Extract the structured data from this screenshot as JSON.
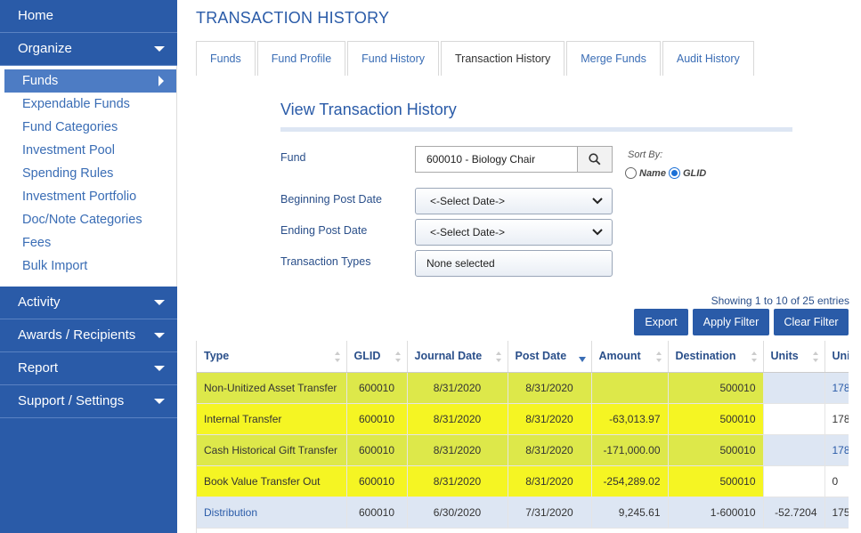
{
  "sidebar": {
    "home": "Home",
    "organize": "Organize",
    "organize_items": [
      "Funds",
      "Expendable Funds",
      "Fund Categories",
      "Investment Pool",
      "Spending Rules",
      "Investment Portfolio",
      "Doc/Note Categories",
      "Fees",
      "Bulk Import"
    ],
    "activity": "Activity",
    "awards": "Awards / Recipients",
    "report": "Report",
    "support": "Support / Settings"
  },
  "page": {
    "title": "TRANSACTION HISTORY"
  },
  "tabs": [
    "Funds",
    "Fund Profile",
    "Fund History",
    "Transaction History",
    "Merge Funds",
    "Audit History"
  ],
  "form": {
    "title": "View Transaction History",
    "fund_label": "Fund",
    "fund_value": "600010 - Biology Chair",
    "sort_by_label": "Sort By:",
    "sort_name": "Name",
    "sort_glid": "GLID",
    "sort_selected": "GLID",
    "begin_label": "Beginning Post Date",
    "begin_value": "<-Select Date->",
    "end_label": "Ending Post Date",
    "end_value": "<-Select Date->",
    "types_label": "Transaction Types",
    "types_value": "None selected"
  },
  "toolbar": {
    "showing": "Showing 1 to 10 of 25 entries",
    "export": "Export",
    "apply": "Apply Filter",
    "clear": "Clear Filter"
  },
  "table": {
    "columns": [
      "Type",
      "GLID",
      "Journal Date",
      "Post Date",
      "Amount",
      "Destination",
      "Units",
      "Uni"
    ],
    "rows": [
      [
        "Non-Unitized Asset Transfer",
        "600010",
        "8/31/2020",
        "8/31/2020",
        "",
        "500010",
        "",
        "178"
      ],
      [
        "Internal Transfer",
        "600010",
        "8/31/2020",
        "8/31/2020",
        "-63,013.97",
        "500010",
        "",
        "178"
      ],
      [
        "Cash Historical Gift Transfer",
        "600010",
        "8/31/2020",
        "8/31/2020",
        "-171,000.00",
        "500010",
        "",
        "178"
      ],
      [
        "Book Value Transfer Out",
        "600010",
        "8/31/2020",
        "8/31/2020",
        "-254,289.02",
        "500010",
        "",
        "0"
      ],
      [
        "Distribution",
        "600010",
        "6/30/2020",
        "7/31/2020",
        "9,245.61",
        "1-600010",
        "-52.7204",
        "175"
      ]
    ]
  },
  "colors": {
    "accent": "#2a5ba8",
    "highlight": "#f5f523",
    "stripe": "#dde6f3"
  }
}
